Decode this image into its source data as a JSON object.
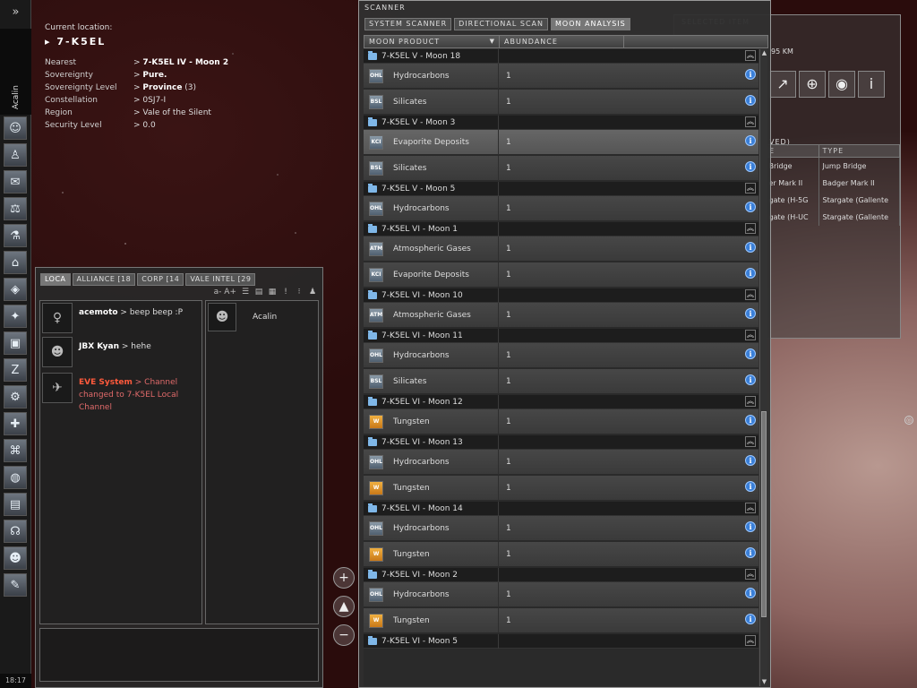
{
  "neocom": {
    "character_name": "Acalin",
    "clock": "18:17",
    "buttons": [
      "people-icon",
      "character-icon",
      "mail-icon",
      "market-icon",
      "science-icon",
      "corp-icon",
      "map-icon",
      "starmap-icon",
      "assets-icon",
      "zzz-icon",
      "fitting-icon",
      "help-icon",
      "wallet-icon",
      "planet-icon",
      "journal-icon",
      "headset-icon",
      "portrait-icon",
      "notepad-icon"
    ]
  },
  "location": {
    "label": "Current location:",
    "system": "7-K5EL",
    "rows": [
      {
        "key": "Nearest",
        "value": "7-K5EL IV - Moon 2",
        "bold": true
      },
      {
        "key": "Sovereignty",
        "value": "Pure.",
        "bold": true
      },
      {
        "key": "Sovereignty Level",
        "value": "Province",
        "extra": "(3)"
      },
      {
        "key": "Constellation",
        "value": "0SJ7-I"
      },
      {
        "key": "Region",
        "value": "Vale of the Silent"
      },
      {
        "key": "Security Level",
        "value": "0.0"
      }
    ]
  },
  "chat": {
    "tabs": [
      "LOCA",
      "ALLIANCE [18",
      "CORP [14",
      "VALE INTEL [29"
    ],
    "toolbar": {
      "font_size": "a- A+"
    },
    "messages": [
      {
        "who": "acemoto",
        "text": "beep beep :P"
      },
      {
        "who": "JBX Kyan",
        "text": "hehe"
      },
      {
        "who": "EVE System",
        "text": "Channel changed to 7-K5EL Local Channel",
        "system": true
      }
    ],
    "members": [
      {
        "name": "Acalin"
      }
    ]
  },
  "selected_item": {
    "header": "SELECTED ITEM",
    "distance": "95 KM",
    "overview_label": "VED)",
    "table": {
      "headers": [
        "E",
        "TYPE"
      ],
      "rows": [
        [
          "Bridge",
          "Jump Bridge"
        ],
        [
          "er Mark II",
          "Badger Mark II"
        ],
        [
          "gate (H-5G",
          "Stargate (Gallente"
        ],
        [
          "gate (H-UC",
          "Stargate (Gallente"
        ]
      ]
    }
  },
  "scanner": {
    "title": "SCANNER",
    "tabs": [
      "SYSTEM SCANNER",
      "DIRECTIONAL SCAN",
      "MOON ANALYSIS"
    ],
    "active_tab": 2,
    "columns": [
      "MOON PRODUCT",
      "ABUNDANCE"
    ],
    "groups": [
      {
        "name": "7-K5EL V - Moon 18",
        "items": [
          {
            "product": "Hydrocarbons",
            "code": "OHL",
            "abundance": "1"
          },
          {
            "product": "Silicates",
            "code": "BSL",
            "abundance": "1"
          }
        ]
      },
      {
        "name": "7-K5EL V - Moon 3",
        "items": [
          {
            "product": "Evaporite Deposits",
            "code": "KCI",
            "abundance": "1",
            "highlight": true
          },
          {
            "product": "Silicates",
            "code": "BSL",
            "abundance": "1"
          }
        ]
      },
      {
        "name": "7-K5EL V - Moon 5",
        "items": [
          {
            "product": "Hydrocarbons",
            "code": "OHL",
            "abundance": "1"
          }
        ]
      },
      {
        "name": "7-K5EL VI - Moon 1",
        "items": [
          {
            "product": "Atmospheric Gases",
            "code": "ATM",
            "abundance": "1"
          },
          {
            "product": "Evaporite Deposits",
            "code": "KCI",
            "abundance": "1"
          }
        ]
      },
      {
        "name": "7-K5EL VI - Moon 10",
        "items": [
          {
            "product": "Atmospheric Gases",
            "code": "ATM",
            "abundance": "1"
          }
        ]
      },
      {
        "name": "7-K5EL VI - Moon 11",
        "items": [
          {
            "product": "Hydrocarbons",
            "code": "OHL",
            "abundance": "1"
          },
          {
            "product": "Silicates",
            "code": "BSL",
            "abundance": "1"
          }
        ]
      },
      {
        "name": "7-K5EL VI - Moon 12",
        "items": [
          {
            "product": "Tungsten",
            "code": "W",
            "abundance": "1",
            "metal": true
          }
        ]
      },
      {
        "name": "7-K5EL VI - Moon 13",
        "items": [
          {
            "product": "Hydrocarbons",
            "code": "OHL",
            "abundance": "1"
          },
          {
            "product": "Tungsten",
            "code": "W",
            "abundance": "1",
            "metal": true
          }
        ]
      },
      {
        "name": "7-K5EL VI - Moon 14",
        "items": [
          {
            "product": "Hydrocarbons",
            "code": "OHL",
            "abundance": "1"
          },
          {
            "product": "Tungsten",
            "code": "W",
            "abundance": "1",
            "metal": true
          }
        ]
      },
      {
        "name": "7-K5EL VI - Moon 2",
        "items": [
          {
            "product": "Hydrocarbons",
            "code": "OHL",
            "abundance": "1"
          },
          {
            "product": "Tungsten",
            "code": "W",
            "abundance": "1",
            "metal": true
          }
        ]
      },
      {
        "name": "7-K5EL VI - Moon 5",
        "items": []
      }
    ]
  },
  "colors": {
    "accent": "#3a7fd8",
    "system_msg": "#ff5a3c",
    "tungsten": "#e8a030"
  }
}
